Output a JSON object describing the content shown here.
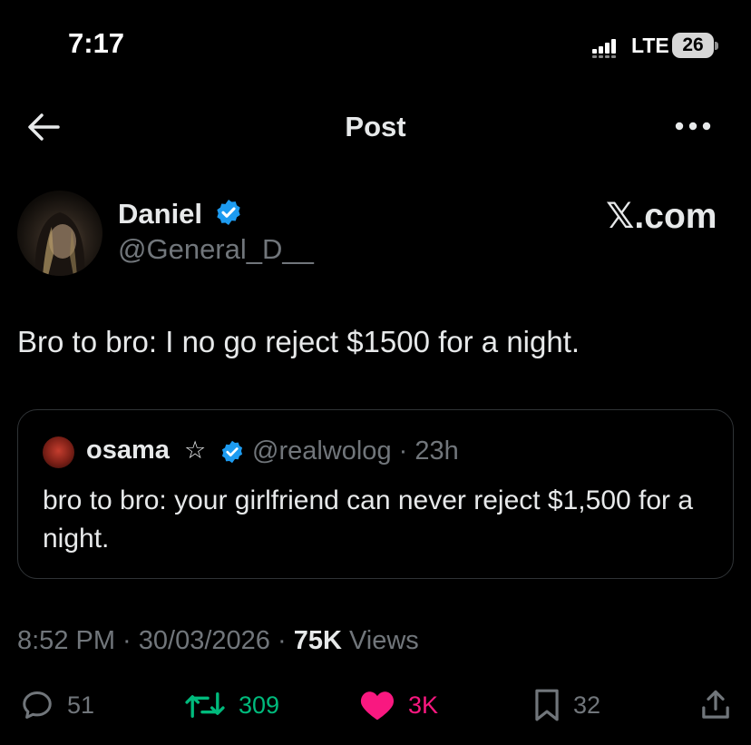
{
  "status_bar": {
    "time": "7:17",
    "network": "LTE",
    "battery": "26"
  },
  "nav": {
    "title": "Post"
  },
  "author": {
    "name": "Daniel",
    "handle": "@General_D__",
    "verified": true
  },
  "watermark": "𝕏.com",
  "tweet": {
    "text": "Bro to bro: I no go reject $1500 for a night."
  },
  "quote": {
    "name": "osama",
    "star": "☆",
    "handle_time": "@realwolog · 23h",
    "text": "bro to bro: your girlfriend can never reject $1,500 for a night."
  },
  "meta": {
    "time_date": "8:52 PM · 30/03/2026 · ",
    "views_count": "75K",
    "views_label": " Views"
  },
  "actions": {
    "replies": "51",
    "reposts": "309",
    "likes": "3K",
    "bookmarks": "32"
  },
  "colors": {
    "background": "#000000",
    "text": "#e7e9ea",
    "secondary": "#71767b",
    "verified": "#1d9bf0",
    "repost": "#00ba7c",
    "like": "#f91880",
    "border": "#2f3336"
  }
}
